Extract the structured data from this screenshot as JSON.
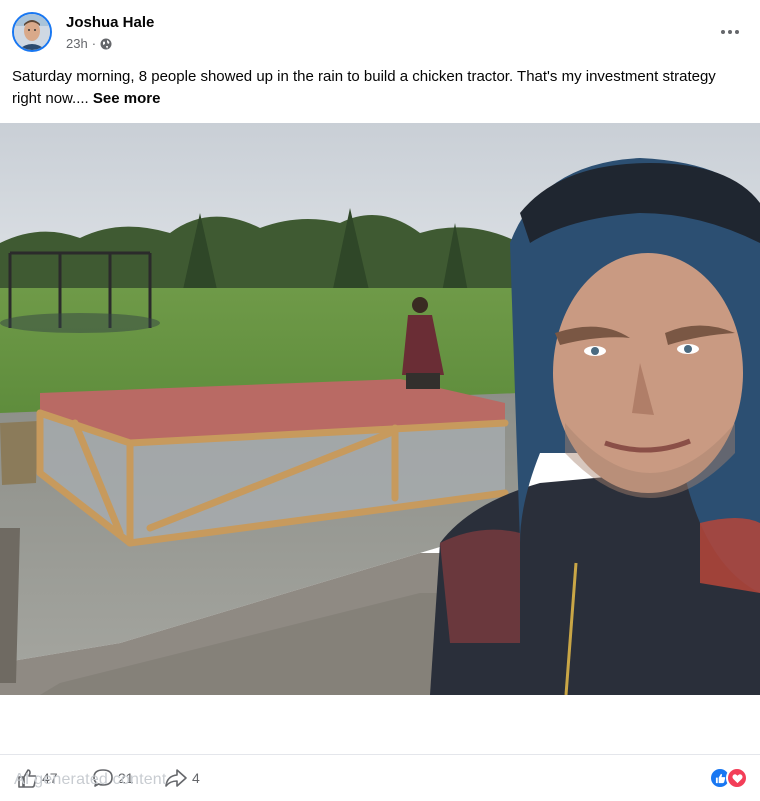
{
  "post": {
    "author": "Joshua Hale",
    "time": "23h",
    "privacy_icon": "globe-icon",
    "caption": "Saturday morning, 8 people showed up in the rain to build a chicken tractor. That's my investment strategy right now....",
    "see_more": "See more"
  },
  "stats": {
    "likes": "47",
    "comments": "21",
    "shares": "4",
    "ai_label": "AI generated content"
  },
  "colors": {
    "accent": "#1877f2",
    "love": "#f33e58",
    "secondary_text": "#65676b"
  }
}
